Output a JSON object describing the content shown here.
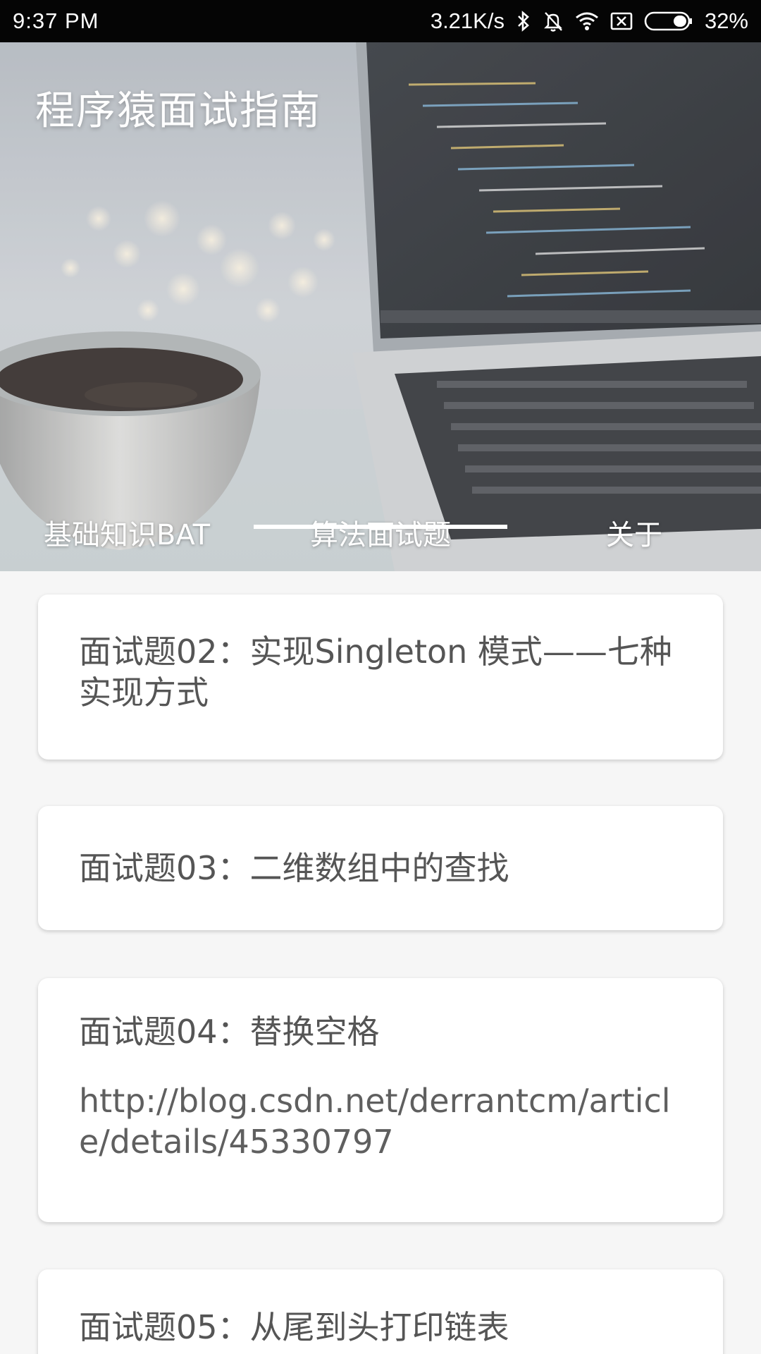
{
  "status_bar": {
    "time": "9:37 PM",
    "net_speed": "3.21K/s",
    "battery": "32%",
    "icons": [
      "bluetooth-icon",
      "mute-icon",
      "wifi-icon",
      "sim-off-icon",
      "battery-icon"
    ]
  },
  "app": {
    "title": "程序猿面试指南"
  },
  "tabs": [
    {
      "label": "基础知识BAT",
      "selected": false
    },
    {
      "label": "算法面试题",
      "selected": true
    },
    {
      "label": "关于",
      "selected": false
    }
  ],
  "cards": [
    {
      "title": "面试题02：实现Singleton 模式——七种实现方式"
    },
    {
      "title": "面试题03：二维数组中的查找"
    },
    {
      "title": "面试题04：替换空格",
      "link": "http://blog.csdn.net/derrantcm/article/details/45330797"
    },
    {
      "title": "面试题05：从尾到头打印链表"
    }
  ],
  "colors": {
    "status_bar": "#050505",
    "background": "#f6f6f6",
    "card": "#ffffff",
    "text": "#555555",
    "indicator": "#ffffff"
  }
}
